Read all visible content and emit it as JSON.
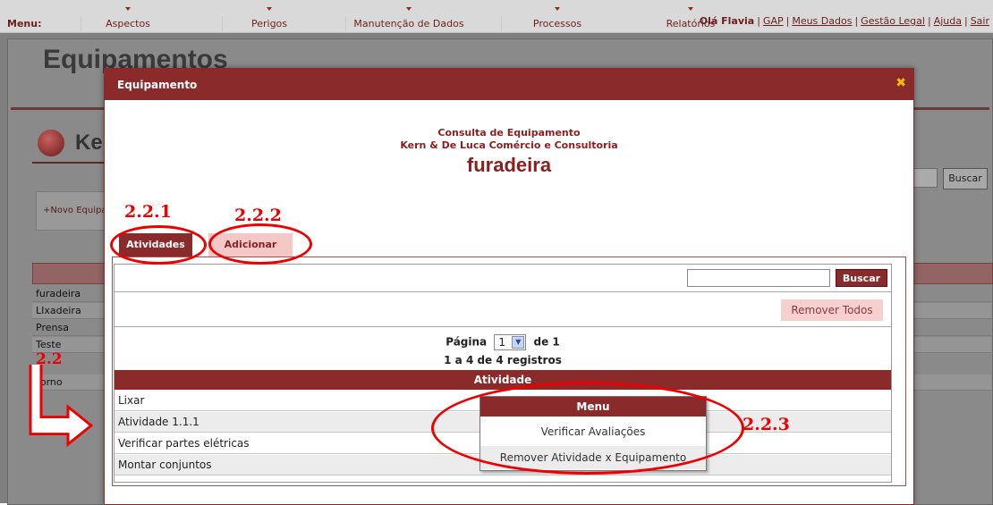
{
  "topbar": {
    "menu_label": "Menu:",
    "items": [
      "Aspectos",
      "Perigos",
      "Manutenção de Dados",
      "Processos",
      "Relatórios"
    ],
    "user": "Flavia",
    "user_prefix": "Olá",
    "links": [
      "GAP",
      "Meus Dados",
      "Gestão Legal",
      "Ajuda",
      "Sair"
    ]
  },
  "background": {
    "page_title": "Equipamentos",
    "section_title": "Kern & De Luca",
    "new_button": "+Novo Equipamento",
    "search_button": "Buscar",
    "rows": [
      "furadeira",
      "LIxadeira",
      "Prensa",
      "Teste",
      "Torno"
    ]
  },
  "modal": {
    "title": "Equipamento",
    "close_icon": "close-x",
    "consulta": "Consulta de Equipamento",
    "company": "Kern & De Luca Comércio e Consultoria",
    "equipment": "furadeira",
    "tabs": [
      {
        "label": "Atividades",
        "active": true
      },
      {
        "label": "Adicionar",
        "active": false
      }
    ],
    "search_button": "Buscar",
    "remove_all": "Remover Todos",
    "pager": {
      "page_label": "Página",
      "page_value": "1",
      "of_label": "de 1",
      "records": "1 a 4 de 4 registros"
    },
    "column_header": "Atividade",
    "activities": [
      "Lixar",
      "Atividade 1.1.1",
      "Verificar partes elétricas",
      "Montar conjuntos"
    ]
  },
  "context_menu": {
    "title": "Menu",
    "items": [
      "Verificar Avaliações",
      "Remover Atividade x Equipamento"
    ]
  },
  "annotations": {
    "a1": "2.2.1",
    "a2": "2.2.2",
    "a3": "2.2.3",
    "a4": "2.2"
  },
  "colors": {
    "brand": "#8b2a2a",
    "tab_inactive": "#f5c8c8",
    "annotation": "#ee0000"
  }
}
